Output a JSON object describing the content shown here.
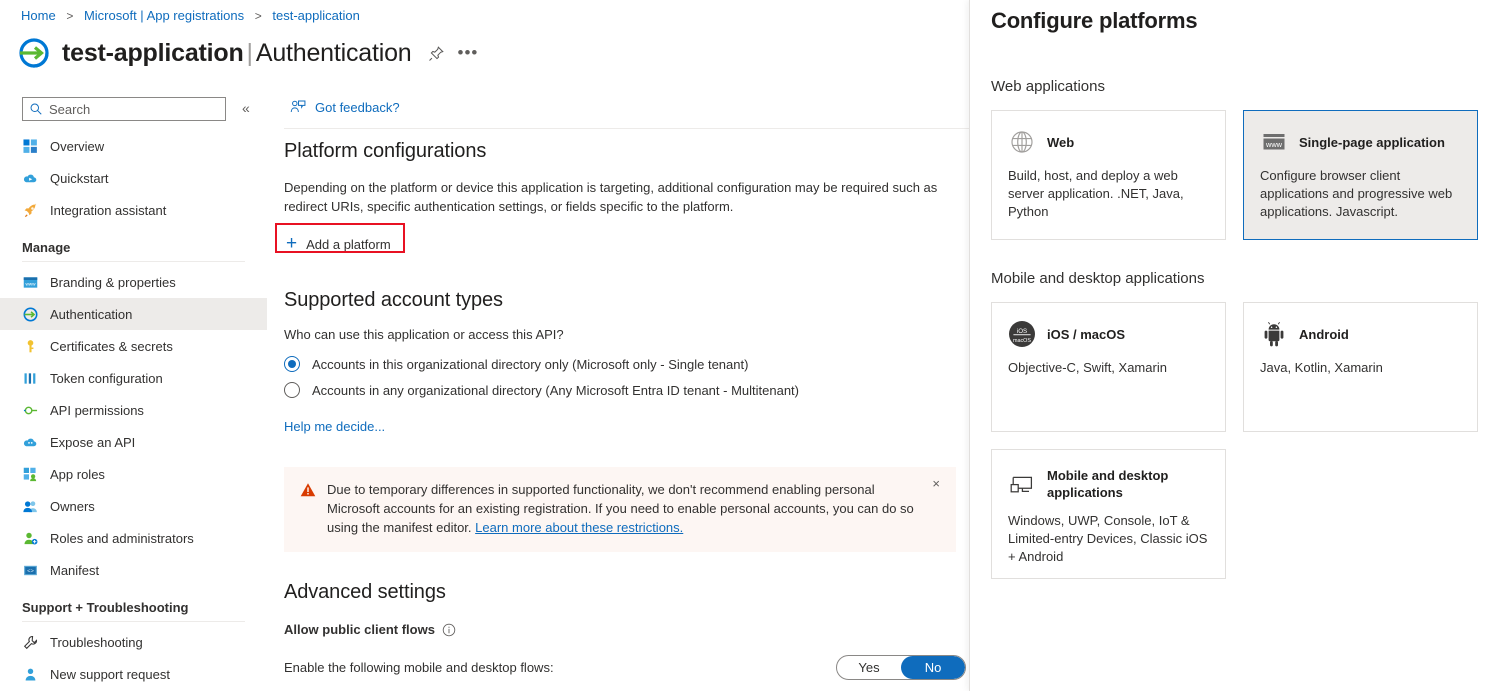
{
  "breadcrumb": {
    "items": [
      {
        "label": "Home"
      },
      {
        "label": "Microsoft | App registrations"
      },
      {
        "label": "test-application"
      }
    ],
    "separator": ">"
  },
  "header": {
    "app_icon_name": "app-registration-icon",
    "title_primary": "test-application",
    "title_separator": "|",
    "title_secondary": "Authentication",
    "pin_icon": "pin-icon",
    "more_label": "•••"
  },
  "search": {
    "placeholder": "Search",
    "value": "",
    "icon": "search-icon"
  },
  "collapse": {
    "glyph": "«",
    "name": "collapse-sidebar-button"
  },
  "toolbar": {
    "feedback_label": "Got feedback?",
    "feedback_icon": "feedback-person-icon"
  },
  "sidebar": {
    "items": [
      {
        "label": "Overview",
        "icon": "overview-grid-icon",
        "selected": false
      },
      {
        "label": "Quickstart",
        "icon": "quickstart-cloud-icon",
        "selected": false
      },
      {
        "label": "Integration assistant",
        "icon": "rocket-icon",
        "selected": false
      }
    ],
    "groups": [
      {
        "title": "Manage",
        "items": [
          {
            "label": "Branding & properties",
            "icon": "branding-window-icon",
            "selected": false
          },
          {
            "label": "Authentication",
            "icon": "authentication-arrow-icon",
            "selected": true
          },
          {
            "label": "Certificates & secrets",
            "icon": "key-icon",
            "selected": false
          },
          {
            "label": "Token configuration",
            "icon": "token-bars-icon",
            "selected": false
          },
          {
            "label": "API permissions",
            "icon": "api-permissions-icon",
            "selected": false
          },
          {
            "label": "Expose an API",
            "icon": "expose-api-cloud-icon",
            "selected": false
          },
          {
            "label": "App roles",
            "icon": "app-roles-icon",
            "selected": false
          },
          {
            "label": "Owners",
            "icon": "owners-people-icon",
            "selected": false
          },
          {
            "label": "Roles and administrators",
            "icon": "roles-admin-icon",
            "selected": false
          },
          {
            "label": "Manifest",
            "icon": "manifest-code-icon",
            "selected": false
          }
        ]
      },
      {
        "title": "Support + Troubleshooting",
        "items": [
          {
            "label": "Troubleshooting",
            "icon": "wrench-icon",
            "selected": false
          },
          {
            "label": "New support request",
            "icon": "support-person-icon",
            "selected": false
          }
        ]
      }
    ]
  },
  "main": {
    "platform_configurations": {
      "heading": "Platform configurations",
      "description": "Depending on the platform or device this application is targeting, additional configuration may be required such as redirect URIs, specific authentication settings, or fields specific to the platform.",
      "add_platform_label": "Add a platform",
      "add_platform_plus": "+",
      "highlight_color": "#e81123"
    },
    "supported_account_types": {
      "heading": "Supported account types",
      "question": "Who can use this application or access this API?",
      "options": [
        {
          "label": "Accounts in this organizational directory only (Microsoft only - Single tenant)",
          "selected": true
        },
        {
          "label": "Accounts in any organizational directory (Any Microsoft Entra ID tenant - Multitenant)",
          "selected": false
        }
      ],
      "help_link": "Help me decide..."
    },
    "warning_banner": {
      "icon": "warning-triangle-icon",
      "text": "Due to temporary differences in supported functionality, we don't recommend enabling personal Microsoft accounts for an existing registration. If you need to enable personal accounts, you can do so using the manifest editor.",
      "link_text": "Learn more about these restrictions.",
      "close_glyph": "×",
      "background": "#fdf6f3",
      "icon_color": "#d83b01"
    },
    "advanced_settings": {
      "heading": "Advanced settings",
      "allow_public_client_flows_label": "Allow public client flows",
      "info_icon": "info-icon",
      "flow_label": "Enable the following mobile and desktop flows:",
      "toggle": {
        "yes_label": "Yes",
        "no_label": "No",
        "value": "No",
        "accent": "#0f6cbd"
      }
    }
  },
  "panel": {
    "title": "Configure platforms",
    "sections": [
      {
        "heading": "Web applications",
        "cards": [
          {
            "title": "Web",
            "description": "Build, host, and deploy a web server application. .NET, Java, Python",
            "icon": "globe-icon",
            "selected": false
          },
          {
            "title": "Single-page application",
            "description": "Configure browser client applications and progressive web applications. Javascript.",
            "icon": "www-browser-icon",
            "selected": true
          }
        ]
      },
      {
        "heading": "Mobile and desktop applications",
        "cards": [
          {
            "title": "iOS / macOS",
            "description": "Objective-C, Swift, Xamarin",
            "icon": "ios-macos-icon",
            "selected": false
          },
          {
            "title": "Android",
            "description": "Java, Kotlin, Xamarin",
            "icon": "android-icon",
            "selected": false
          },
          {
            "title": "Mobile and desktop applications",
            "description": "Windows, UWP, Console, IoT & Limited-entry Devices, Classic iOS + Android",
            "icon": "monitor-device-icon",
            "selected": false
          }
        ]
      }
    ]
  }
}
